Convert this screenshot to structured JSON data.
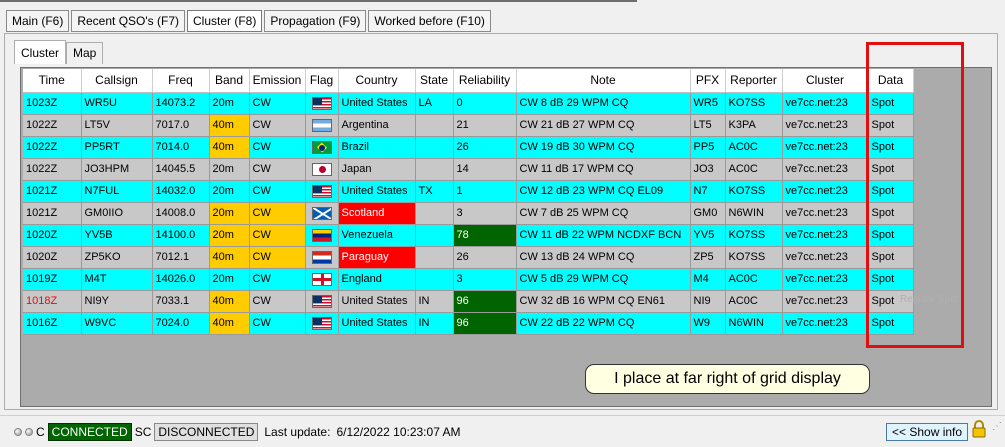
{
  "main_tabs": [
    "Main (F6)",
    "Recent QSO's (F7)",
    "Cluster (F8)",
    "Propagation (F9)",
    "Worked before (F10)"
  ],
  "sub_tabs": [
    "Cluster",
    "Map"
  ],
  "grid": {
    "columns": [
      "Time",
      "Callsign",
      "Freq",
      "Band",
      "Emission",
      "Flag",
      "Country",
      "State",
      "Reliability",
      "Note",
      "PFX",
      "Reporter",
      "Cluster",
      "Data"
    ],
    "rows": [
      {
        "time": "1023Z",
        "callsign": "WR5U",
        "freq": "14073.2",
        "band": "20m",
        "emission": "CW",
        "flag": "us-flag-icon",
        "country": "United States",
        "state": "LA",
        "reliability": "0",
        "note": "CW  8 dB 29 WPM CQ",
        "pfx": "WR5",
        "reporter": "KO7SS",
        "cluster": "ve7cc.net:23",
        "data": "Spot"
      },
      {
        "time": "1022Z",
        "callsign": "LT5V",
        "freq": "7017.0",
        "band": "40m",
        "emission": "CW",
        "flag": "argentina-flag-icon",
        "country": "Argentina",
        "state": "",
        "reliability": "21",
        "note": "CW 21 dB 27 WPM CQ",
        "pfx": "LT5",
        "reporter": "K3PA",
        "cluster": "ve7cc.net:23",
        "data": "Spot"
      },
      {
        "time": "1022Z",
        "callsign": "PP5RT",
        "freq": "7014.0",
        "band": "40m",
        "emission": "CW",
        "flag": "brazil-flag-icon",
        "country": "Brazil",
        "state": "",
        "reliability": "26",
        "note": "CW 19 dB 30 WPM CQ",
        "pfx": "PP5",
        "reporter": "AC0C",
        "cluster": "ve7cc.net:23",
        "data": "Spot"
      },
      {
        "time": "1022Z",
        "callsign": "JO3HPM",
        "freq": "14045.5",
        "band": "20m",
        "emission": "CW",
        "flag": "japan-flag-icon",
        "country": "Japan",
        "state": "",
        "reliability": "14",
        "note": "CW 11 dB 17 WPM CQ",
        "pfx": "JO3",
        "reporter": "AC0C",
        "cluster": "ve7cc.net:23",
        "data": "Spot"
      },
      {
        "time": "1021Z",
        "callsign": "N7FUL",
        "freq": "14032.0",
        "band": "20m",
        "emission": "CW",
        "flag": "us-flag-icon",
        "country": "United States",
        "state": "TX",
        "reliability": "1",
        "note": "CW 12 dB 23 WPM CQ         EL09",
        "pfx": "N7",
        "reporter": "KO7SS",
        "cluster": "ve7cc.net:23",
        "data": "Spot"
      },
      {
        "time": "1021Z",
        "callsign": "GM0IIO",
        "freq": "14008.0",
        "band": "20m",
        "emission": "CW",
        "flag": "scotland-flag-icon",
        "country": "Scotland",
        "state": "",
        "reliability": "3",
        "note": "CW  7 dB 25 WPM CQ",
        "pfx": "GM0",
        "reporter": "N6WIN",
        "cluster": "ve7cc.net:23",
        "data": "Spot"
      },
      {
        "time": "1020Z",
        "callsign": "YV5B",
        "freq": "14100.0",
        "band": "20m",
        "emission": "CW",
        "flag": "venezuela-flag-icon",
        "country": "Venezuela",
        "state": "",
        "reliability": "78",
        "note": "CW 11 dB 22 WPM NCDXF BCN",
        "pfx": "YV5",
        "reporter": "KO7SS",
        "cluster": "ve7cc.net:23",
        "data": "Spot"
      },
      {
        "time": "1020Z",
        "callsign": "ZP5KO",
        "freq": "7012.1",
        "band": "40m",
        "emission": "CW",
        "flag": "paraguay-flag-icon",
        "country": "Paraguay",
        "state": "",
        "reliability": "26",
        "note": "CW 13 dB 24 WPM CQ",
        "pfx": "ZP5",
        "reporter": "KO7SS",
        "cluster": "ve7cc.net:23",
        "data": "Spot"
      },
      {
        "time": "1019Z",
        "callsign": "M4T",
        "freq": "14026.0",
        "band": "20m",
        "emission": "CW",
        "flag": "england-flag-icon",
        "country": "England",
        "state": "",
        "reliability": "3",
        "note": "CW  5 dB 29 WPM CQ",
        "pfx": "M4",
        "reporter": "AC0C",
        "cluster": "ve7cc.net:23",
        "data": "Spot"
      },
      {
        "time": "1018Z",
        "callsign": "NI9Y",
        "freq": "7033.1",
        "band": "40m",
        "emission": "CW",
        "flag": "us-flag-icon",
        "country": "United States",
        "state": "IN",
        "reliability": "96",
        "note": "CW 32 dB 16 WPM CQ          EN61",
        "pfx": "NI9",
        "reporter": "AC0C",
        "cluster": "ve7cc.net:23",
        "data": "Spot"
      },
      {
        "time": "1016Z",
        "callsign": "W9VC",
        "freq": "7024.0",
        "band": "40m",
        "emission": "CW",
        "flag": "us-flag-icon",
        "country": "United States",
        "state": "IN",
        "reliability": "96",
        "note": "CW 22 dB 22 WPM CQ",
        "pfx": "W9",
        "reporter": "N6WIN",
        "cluster": "ve7cc.net:23",
        "data": "Spot"
      }
    ]
  },
  "callout_text": "I place at far right of grid display",
  "ghost_text": "Regular Spot",
  "status": {
    "c_label": "C",
    "connected_label": "CONNECTED",
    "sc_label": "SC",
    "disconnected_label": "DISCONNECTED",
    "last_update_label": "Last update:",
    "last_update_value": "6/12/2022 10:23:07 AM",
    "show_info_label": "<< Show info"
  },
  "colors": {
    "row_cyan": "#00ffff",
    "row_gray": "#c8c8c8",
    "highlight_yellow": "#ffcc00",
    "highlight_red": "#ff0000",
    "highlight_green": "#006400",
    "annotation_red": "#e01010"
  }
}
